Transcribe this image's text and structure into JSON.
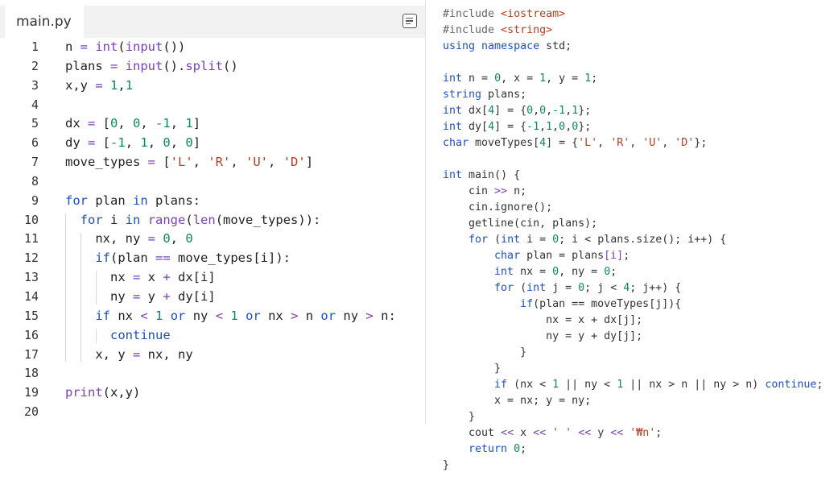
{
  "editor": {
    "tab_label": "main.py",
    "menu_icon": "menu-icon",
    "lines": [
      {
        "n": "1",
        "t": [
          [
            "v",
            "n"
          ],
          [
            "o",
            " = "
          ],
          [
            "f",
            "int"
          ],
          [
            "p",
            "("
          ],
          [
            "f",
            "input"
          ],
          [
            "p",
            "())"
          ]
        ]
      },
      {
        "n": "2",
        "t": [
          [
            "v",
            "plans"
          ],
          [
            "o",
            " = "
          ],
          [
            "f",
            "input"
          ],
          [
            "p",
            "()."
          ],
          [
            "f",
            "split"
          ],
          [
            "p",
            "()"
          ]
        ]
      },
      {
        "n": "3",
        "t": [
          [
            "v",
            "x,y"
          ],
          [
            "o",
            " = "
          ],
          [
            "num",
            "1"
          ],
          [
            "p",
            ","
          ],
          [
            "num",
            "1"
          ]
        ]
      },
      {
        "n": "4",
        "t": []
      },
      {
        "n": "5",
        "t": [
          [
            "v",
            "dx"
          ],
          [
            "o",
            " = "
          ],
          [
            "p",
            "["
          ],
          [
            "num",
            "0"
          ],
          [
            "p",
            ", "
          ],
          [
            "num",
            "0"
          ],
          [
            "p",
            ", "
          ],
          [
            "num",
            "-1"
          ],
          [
            "p",
            ", "
          ],
          [
            "num",
            "1"
          ],
          [
            "p",
            "]"
          ]
        ]
      },
      {
        "n": "6",
        "t": [
          [
            "v",
            "dy"
          ],
          [
            "o",
            " = "
          ],
          [
            "p",
            "["
          ],
          [
            "num",
            "-1"
          ],
          [
            "p",
            ", "
          ],
          [
            "num",
            "1"
          ],
          [
            "p",
            ", "
          ],
          [
            "num",
            "0"
          ],
          [
            "p",
            ", "
          ],
          [
            "num",
            "0"
          ],
          [
            "p",
            "]"
          ]
        ]
      },
      {
        "n": "7",
        "t": [
          [
            "v",
            "move_types"
          ],
          [
            "o",
            " = "
          ],
          [
            "p",
            "["
          ],
          [
            "s",
            "'L'"
          ],
          [
            "p",
            ", "
          ],
          [
            "s",
            "'R'"
          ],
          [
            "p",
            ", "
          ],
          [
            "s",
            "'U'"
          ],
          [
            "p",
            ", "
          ],
          [
            "s",
            "'D'"
          ],
          [
            "p",
            "]"
          ]
        ]
      },
      {
        "n": "8",
        "t": []
      },
      {
        "n": "9",
        "t": [
          [
            "k",
            "for"
          ],
          [
            "v",
            " plan "
          ],
          [
            "k",
            "in"
          ],
          [
            "v",
            " plans"
          ],
          [
            "p",
            ":"
          ]
        ]
      },
      {
        "n": "10",
        "t": [
          [
            "v",
            "  "
          ],
          [
            "k",
            "for"
          ],
          [
            "v",
            " i "
          ],
          [
            "k",
            "in"
          ],
          [
            "v",
            " "
          ],
          [
            "f",
            "range"
          ],
          [
            "p",
            "("
          ],
          [
            "f",
            "len"
          ],
          [
            "p",
            "("
          ],
          [
            "v",
            "move_types"
          ],
          [
            "p",
            "))"
          ],
          [
            "p",
            ":"
          ]
        ]
      },
      {
        "n": "11",
        "t": [
          [
            "v",
            "    nx, ny"
          ],
          [
            "o",
            " = "
          ],
          [
            "num",
            "0"
          ],
          [
            "p",
            ", "
          ],
          [
            "num",
            "0"
          ]
        ]
      },
      {
        "n": "12",
        "t": [
          [
            "v",
            "    "
          ],
          [
            "k",
            "if"
          ],
          [
            "p",
            "("
          ],
          [
            "v",
            "plan"
          ],
          [
            "o",
            " == "
          ],
          [
            "v",
            "move_types[i]"
          ],
          [
            "p",
            "):"
          ]
        ]
      },
      {
        "n": "13",
        "t": [
          [
            "v",
            "      nx"
          ],
          [
            "o",
            " = "
          ],
          [
            "v",
            "x"
          ],
          [
            "o",
            " + "
          ],
          [
            "v",
            "dx[i]"
          ]
        ]
      },
      {
        "n": "14",
        "t": [
          [
            "v",
            "      ny"
          ],
          [
            "o",
            " = "
          ],
          [
            "v",
            "y"
          ],
          [
            "o",
            " + "
          ],
          [
            "v",
            "dy[i]"
          ]
        ]
      },
      {
        "n": "15",
        "t": [
          [
            "v",
            "    "
          ],
          [
            "k",
            "if"
          ],
          [
            "v",
            " nx "
          ],
          [
            "o",
            "<"
          ],
          [
            "v",
            " "
          ],
          [
            "num",
            "1"
          ],
          [
            "v",
            " "
          ],
          [
            "k",
            "or"
          ],
          [
            "v",
            " ny "
          ],
          [
            "o",
            "<"
          ],
          [
            "v",
            " "
          ],
          [
            "num",
            "1"
          ],
          [
            "v",
            " "
          ],
          [
            "k",
            "or"
          ],
          [
            "v",
            " nx "
          ],
          [
            "o",
            ">"
          ],
          [
            "v",
            " n "
          ],
          [
            "k",
            "or"
          ],
          [
            "v",
            " ny "
          ],
          [
            "o",
            ">"
          ],
          [
            "v",
            " n"
          ],
          [
            "p",
            ":"
          ]
        ]
      },
      {
        "n": "16",
        "t": [
          [
            "v",
            "      "
          ],
          [
            "k",
            "continue"
          ]
        ]
      },
      {
        "n": "17",
        "t": [
          [
            "v",
            "    x, y"
          ],
          [
            "o",
            " = "
          ],
          [
            "v",
            "nx, ny"
          ]
        ]
      },
      {
        "n": "18",
        "t": []
      },
      {
        "n": "19",
        "t": [
          [
            "f",
            "print"
          ],
          [
            "p",
            "("
          ],
          [
            "v",
            "x,y"
          ],
          [
            "p",
            ")"
          ]
        ]
      },
      {
        "n": "20",
        "t": []
      }
    ]
  },
  "cpp": {
    "lines": [
      [
        [
          "pp",
          "#include "
        ],
        [
          "inc",
          "<iostream>"
        ]
      ],
      [
        [
          "pp",
          "#include "
        ],
        [
          "inc",
          "<string>"
        ]
      ],
      [
        [
          "kwb",
          "using"
        ],
        [
          "v",
          " "
        ],
        [
          "kwb",
          "namespace"
        ],
        [
          "v",
          " std;"
        ]
      ],
      [],
      [
        [
          "kwb",
          "int"
        ],
        [
          "v",
          " n = "
        ],
        [
          "num",
          "0"
        ],
        [
          "v",
          ", x = "
        ],
        [
          "num",
          "1"
        ],
        [
          "v",
          ", y = "
        ],
        [
          "num",
          "1"
        ],
        [
          "v",
          ";"
        ]
      ],
      [
        [
          "typ",
          "string"
        ],
        [
          "v",
          " plans;"
        ]
      ],
      [
        [
          "kwb",
          "int"
        ],
        [
          "v",
          " dx["
        ],
        [
          "num",
          "4"
        ],
        [
          "v",
          "] = {"
        ],
        [
          "num",
          "0"
        ],
        [
          "v",
          ","
        ],
        [
          "num",
          "0"
        ],
        [
          "v",
          ","
        ],
        [
          "num",
          "-1"
        ],
        [
          "v",
          ","
        ],
        [
          "num",
          "1"
        ],
        [
          "v",
          "};"
        ]
      ],
      [
        [
          "kwb",
          "int"
        ],
        [
          "v",
          " dy["
        ],
        [
          "num",
          "4"
        ],
        [
          "v",
          "] = {"
        ],
        [
          "num",
          "-1"
        ],
        [
          "v",
          ","
        ],
        [
          "num",
          "1"
        ],
        [
          "v",
          ","
        ],
        [
          "num",
          "0"
        ],
        [
          "v",
          ","
        ],
        [
          "num",
          "0"
        ],
        [
          "v",
          "};"
        ]
      ],
      [
        [
          "kwb",
          "char"
        ],
        [
          "v",
          " moveTypes["
        ],
        [
          "num",
          "4"
        ],
        [
          "v",
          "] = {"
        ],
        [
          "str",
          "'L'"
        ],
        [
          "v",
          ", "
        ],
        [
          "str",
          "'R'"
        ],
        [
          "v",
          ", "
        ],
        [
          "str",
          "'U'"
        ],
        [
          "v",
          ", "
        ],
        [
          "str",
          "'D'"
        ],
        [
          "v",
          "};"
        ]
      ],
      [],
      [
        [
          "kwb",
          "int"
        ],
        [
          "v",
          " main() {"
        ]
      ],
      [
        [
          "v",
          "    cin "
        ],
        [
          "op",
          ">>"
        ],
        [
          "v",
          " n;"
        ]
      ],
      [
        [
          "v",
          "    cin.ignore();"
        ]
      ],
      [
        [
          "v",
          "    getline(cin, plans);"
        ]
      ],
      [
        [
          "v",
          "    "
        ],
        [
          "kwb",
          "for"
        ],
        [
          "v",
          " ("
        ],
        [
          "kwb",
          "int"
        ],
        [
          "v",
          " i = "
        ],
        [
          "num",
          "0"
        ],
        [
          "v",
          "; i < plans.size(); i++) {"
        ]
      ],
      [
        [
          "v",
          "        "
        ],
        [
          "kwb",
          "char"
        ],
        [
          "v",
          " plan = plans"
        ],
        [
          "op",
          "[i]"
        ],
        [
          "v",
          ";"
        ]
      ],
      [
        [
          "v",
          "        "
        ],
        [
          "kwb",
          "int"
        ],
        [
          "v",
          " nx = "
        ],
        [
          "num",
          "0"
        ],
        [
          "v",
          ", ny = "
        ],
        [
          "num",
          "0"
        ],
        [
          "v",
          ";"
        ]
      ],
      [
        [
          "v",
          "        "
        ],
        [
          "kwb",
          "for"
        ],
        [
          "v",
          " ("
        ],
        [
          "kwb",
          "int"
        ],
        [
          "v",
          " j = "
        ],
        [
          "num",
          "0"
        ],
        [
          "v",
          "; j < "
        ],
        [
          "num",
          "4"
        ],
        [
          "v",
          "; j++) {"
        ]
      ],
      [
        [
          "v",
          "            "
        ],
        [
          "kwb",
          "if"
        ],
        [
          "v",
          "(plan == moveTypes[j]){"
        ]
      ],
      [
        [
          "v",
          "                nx = x + dx[j];"
        ]
      ],
      [
        [
          "v",
          "                ny = y + dy[j];"
        ]
      ],
      [
        [
          "v",
          "            }"
        ]
      ],
      [
        [
          "v",
          "        }"
        ]
      ],
      [
        [
          "v",
          "        "
        ],
        [
          "kwb",
          "if"
        ],
        [
          "v",
          " (nx < "
        ],
        [
          "num",
          "1"
        ],
        [
          "v",
          " || ny < "
        ],
        [
          "num",
          "1"
        ],
        [
          "v",
          " || nx > n || ny > n) "
        ],
        [
          "kwb",
          "continue"
        ],
        [
          "v",
          ";"
        ]
      ],
      [
        [
          "v",
          "        x = nx; y = ny;"
        ]
      ],
      [
        [
          "v",
          "    }"
        ]
      ],
      [
        [
          "v",
          "    cout "
        ],
        [
          "op",
          "<<"
        ],
        [
          "v",
          " x "
        ],
        [
          "op",
          "<<"
        ],
        [
          "v",
          " "
        ],
        [
          "str",
          "' '"
        ],
        [
          "v",
          " "
        ],
        [
          "op",
          "<<"
        ],
        [
          "v",
          " y "
        ],
        [
          "op",
          "<<"
        ],
        [
          "v",
          " "
        ],
        [
          "str",
          "'₩n'"
        ],
        [
          "v",
          ";"
        ]
      ],
      [
        [
          "v",
          "    "
        ],
        [
          "kwb",
          "return"
        ],
        [
          "v",
          " "
        ],
        [
          "num",
          "0"
        ],
        [
          "v",
          ";"
        ]
      ],
      [
        [
          "v",
          "}"
        ]
      ]
    ]
  },
  "colors": {
    "keyword": "#1b4fc4",
    "builtin": "#7a3fb8",
    "number": "#0a8a5a",
    "string": "#b1401f",
    "text": "#222222"
  }
}
